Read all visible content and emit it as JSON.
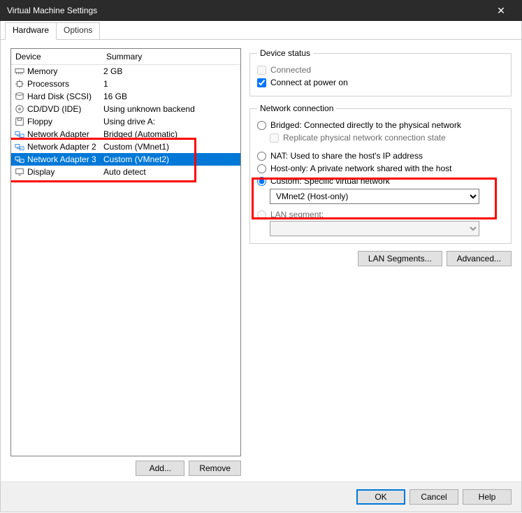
{
  "title": "Virtual Machine Settings",
  "tabs": {
    "hardware": "Hardware",
    "options": "Options"
  },
  "columns": {
    "device": "Device",
    "summary": "Summary"
  },
  "devices": [
    {
      "name": "Memory",
      "summary": "2 GB",
      "icon": "memory"
    },
    {
      "name": "Processors",
      "summary": "1",
      "icon": "cpu"
    },
    {
      "name": "Hard Disk (SCSI)",
      "summary": "16 GB",
      "icon": "disk"
    },
    {
      "name": "CD/DVD (IDE)",
      "summary": "Using unknown backend",
      "icon": "cd"
    },
    {
      "name": "Floppy",
      "summary": "Using drive A:",
      "icon": "floppy"
    },
    {
      "name": "Network Adapter",
      "summary": "Bridged (Automatic)",
      "icon": "net"
    },
    {
      "name": "Network Adapter 2",
      "summary": "Custom (VMnet1)",
      "icon": "net"
    },
    {
      "name": "Network Adapter 3",
      "summary": "Custom (VMnet2)",
      "icon": "net"
    },
    {
      "name": "Display",
      "summary": "Auto detect",
      "icon": "display"
    }
  ],
  "selected_index": 7,
  "left_buttons": {
    "add": "Add...",
    "remove": "Remove"
  },
  "device_status": {
    "legend": "Device status",
    "connected": "Connected",
    "connect_power_on": "Connect at power on"
  },
  "netconn": {
    "legend": "Network connection",
    "bridged": "Bridged: Connected directly to the physical network",
    "replicate": "Replicate physical network connection state",
    "nat": "NAT: Used to share the host's IP address",
    "hostonly": "Host-only: A private network shared with the host",
    "custom": "Custom: Specific virtual network",
    "custom_value": "VMnet2 (Host-only)",
    "lanseg": "LAN segment:",
    "lanseg_value": ""
  },
  "right_buttons": {
    "lan": "LAN Segments...",
    "adv": "Advanced..."
  },
  "footer": {
    "ok": "OK",
    "cancel": "Cancel",
    "help": "Help"
  }
}
